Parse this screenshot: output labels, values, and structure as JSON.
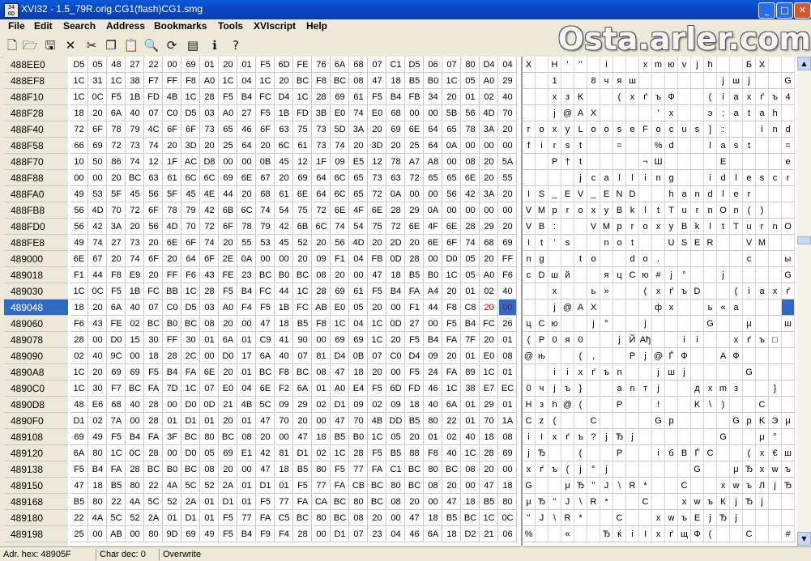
{
  "title": "XVI32 - 1.5_79R.orig.CG1(flash)CG1.smg",
  "app_icon_text": "34 0D",
  "window_buttons": {
    "minimize": "_",
    "maximize": "□",
    "close": "✕"
  },
  "menu": [
    "File",
    "Edit",
    "Search",
    "Address",
    "Bookmarks",
    "Tools",
    "XVIscript",
    "Help"
  ],
  "toolbar": [
    {
      "name": "new-file-icon",
      "glyph": "🗋"
    },
    {
      "name": "open-file-icon",
      "glyph": "🗁"
    },
    {
      "name": "save-icon",
      "glyph": "🖫"
    },
    {
      "name": "close-icon",
      "glyph": "✕"
    },
    {
      "name": "cut-icon",
      "glyph": "✂"
    },
    {
      "name": "copy-icon",
      "glyph": "❐"
    },
    {
      "name": "paste-icon",
      "glyph": "📋"
    },
    {
      "name": "find-icon",
      "glyph": "🔍"
    },
    {
      "name": "replace-icon",
      "glyph": "⟳"
    },
    {
      "name": "settings-icon",
      "glyph": "▤"
    },
    {
      "name": "script-icon",
      "glyph": "ℹ"
    },
    {
      "name": "help-icon",
      "glyph": "?"
    }
  ],
  "watermark": "Osta.arler.com",
  "addresses": [
    "488EE0",
    "488EF8",
    "488F10",
    "488F28",
    "488F40",
    "488F58",
    "488F70",
    "488F88",
    "488FA0",
    "488FB8",
    "488FD0",
    "488FE8",
    "489000",
    "489018",
    "489030",
    "489048",
    "489060",
    "489078",
    "489090",
    "4890A8",
    "4890C0",
    "4890D8",
    "4890F0",
    "489108",
    "489120",
    "489138",
    "489150",
    "489168",
    "489180",
    "489198"
  ],
  "selected_row": 15,
  "hex_rows": [
    "D5 05 48 27 22 00 69 01 20 01 F5 6D FE 76 6A 68 07 C1 D5 06 07 80 D4 04",
    "1C 31 1C 38 F7 FF F8 A0 1C 04 1C 20 BC F8 BC 08 47 18 B5 B0 1C 05 A0 29",
    "1C 0C F5 1B FD 4B 1C 28 F5 B4 FC D4 1C 28 69 61 F5 B4 FB 34 20 01 02 40",
    "18 20 6A 40 07 C0 D5 03 A0 27 F5 1B FD 3B E0 74 E0 68 00 00 5B 56 4D 70",
    "72 6F 78 79 4C 6F 6F 73 65 46 6F 63 75 73 5D 3A 20 69 6E 64 65 78 3A 20",
    "66 69 72 73 74 20 3D 20 25 64 20 6C 61 73 74 20 3D 20 25 64 0A 00 00 00",
    "10 50 86 74 12 1F AC D8 00 00 0B 45 12 1F 09 E5 12 78 A7 A8 00 08 20 5A",
    "00 00 20 BC 63 61 6C 6C 69 6E 67 20 69 64 6C 65 73 63 72 65 65 6E 20 55",
    "49 53 5F 45 56 5F 45 4E 44 20 68 61 6E 64 6C 65 72 0A 00 00 56 42 3A 20",
    "56 4D 70 72 6F 78 79 42 6B 6C 74 54 75 72 6E 4F 6E 28 29 0A 00 00 00 00",
    "56 42 3A 20 56 4D 70 72 6F 78 79 42 6B 6C 74 54 75 72 6E 4F 6E 28 29 20",
    "49 74 27 73 20 6E 6F 74 20 55 53 45 52 20 56 4D 20 2D 20 6E 6F 74 68 69",
    "6E 67 20 74 6F 20 64 6F 2E 0A 00 00 20 09 F1 04 FB 0D 28 00 D0 05 20 FF",
    "F1 44 F8 E9 20 FF F6 43 FE 23 BC B0 BC 08 20 00 47 18 B5 B0 1C 05 A0 F6",
    "1C 0C F5 1B FC BB 1C 28 F5 B4 FC 44 1C 28 69 61 F5 B4 FA A4 20 01 02 40",
    "18 20 6A 40 07 C0 D5 03 A0 F4 F5 1B FC AB E0 05 20 00 F1 44 F8 C8 20 00",
    "F6 43 FE 02 BC B0 BC 08 20 00 47 18 B5 F8 1C 04 1C 0D 27 00 F5 B4 FC 26",
    "28 00 D0 15 30 FF 30 01 6A 01 C9 41 90 00 69 69 1C 20 F5 B4 FA 7F 20 01",
    "02 40 9C 00 18 28 2C 00 D0 17 6A 40 07 81 D4 0B 07 C0 D4 09 20 01 E0 08",
    "1C 20 69 69 F5 B4 FA 6E 20 01 BC F8 BC 08 47 18 20 00 F5 24 FA 89 1C 01",
    "1C 30 F7 BC FA 7D 1C 07 E0 04 6E F2 6A 01 A0 E4 F5 6D FD 46 1C 38 E7 EC",
    "48 E6 68 40 28 00 D0 0D 21 4B 5C 09 29 02 D1 09 02 09 18 40 6A 01 29 01",
    "D1 02 7A 00 28 01 D1 01 20 01 47 70 20 00 47 70 4B DD B5 80 22 01 70 1A",
    "69 49 F5 B4 FA 3F BC 80 BC 08 20 00 47 18 B5 B0 1C 05 20 01 02 40 18 08",
    "6A 80 1C 0C 28 00 D0 05 69 E1 42 81 D1 02 1C 28 F5 B5 88 F8 40 1C 28 69 61",
    "F5 B4 FA 28 BC B0 BC 08 20 00 47 18 B5 80 F5 77 FA C1 BC 80 BC 08 20 00",
    "47 18 B5 80 22 4A 5C 52 2A 01 D1 01 F5 77 FA CB BC 80 BC 08 20 00 47 18",
    "B5 80 22 4A 5C 52 2A 01 D1 01 F5 77 FA CA BC 80 BC 08 20 00 47 18 B5 80",
    "22 4A 5C 52 2A 01 D1 01 F5 77 FA C5 BC 80 BC 08 20 00 47 18 B5 BC 1C 0C",
    "25 00 AB 00 80 9D 69 49 F5 B4 F9 F4 28 00 D1 07 23 04 46 6A 18 D2 21 06"
  ],
  "cursor_red_cells": [
    {
      "row": 15,
      "col": 22
    },
    {
      "row": 15,
      "col": 23
    }
  ],
  "text_rows": [
    "X  H ' \"  i   x m ю v j h   Б X   Ђ Ф",
    "  1   8 ч я ш       j ш j   G   μ °     )",
    "  x з K   ( x ґ ъ Ф   ( i a x ґ ъ 4     @",
    "  j @ A X     ' x   э ; a t a h     [ V M p",
    "r o x y L o o s e F o c u s ] :   i n d e x :",
    "f i r s t   =   % d   l a s t   =   % d",
    "  P † t     ¬ Ш     E     e x § Ё       Z",
    "    j c a l l i n g   i d l e s c r e e n   U",
    "I S _ E V _ E N D   h a n d l e r       V B :",
    "V M p r o x y B k l t T u r n O n ( )",
    "V B :   V M p r o x y B k l t T u r n O n ( )",
    "I t ' s   n o t   U S E R   V M   -   n o t h i",
    "n g   t o   d o .       с   ы   (   Р     я",
    "с D ш й   я ц С ю # j °   j     G   μ °     ц",
    "  x   ь »   ( x ґ ъ D   ( i a x ґ ъ ¤     @",
    "  j @ A X     ф x   ь « a     с D ш И",
    "ц С ю   ј °   j     G   μ   ш       x ґ ъ &",
    "( Р 0 я 0   j Й Aђ   i i   x ґ ъ □",
    "@ њ   ( ,   Р j @ Ѓ Ф   A Ф       а",
    "  i i x ґ ъ n   ј ш j     G     x $ ъ ‰",
    "0 ч j ъ }   а n т j   д х m з   }   8 з м",
    "H з h @ (   P   !   K \\ )   С     @ j   )",
    "С z (   С     G p     G p K Э μ Ђ \"   р",
    "i I x ґ ъ ? j Ђ j       G   μ °       @",
    "j Ђ   (   Р   i б В Ѓ С   ( x € ш @ ( i a",
    "x ґ ъ ( j ° j       G   μ Ђ x w ъ Б j Ђ j",
    "G   μ Ђ \" J \\ R *   С   x w ъ Л j Ђ j     G",
    "μ Ђ \" J \\ R *   С   x w ъ К j Ђ j     G   μ Ђ",
    "\" J \\ R *   С   x w ъ Е j Ђ j     G   j",
    "%   «   Ђ ќ i I x ґ щ Ф (   С   #   F j   T !"
  ],
  "status": {
    "address": "Adr. hex: 48905F",
    "char": "Char dec: 0",
    "mode": "Overwrite"
  }
}
